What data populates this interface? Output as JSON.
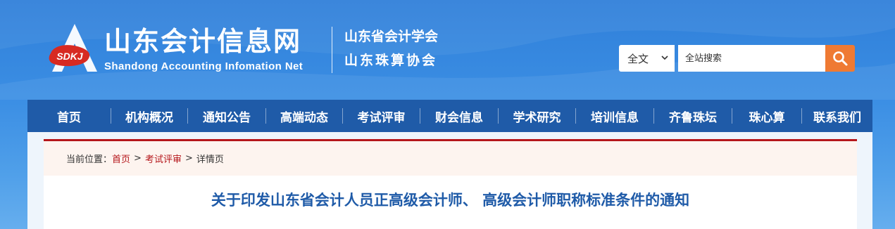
{
  "site": {
    "title": "山东会计信息网",
    "subtitle": "Shandong Accounting Infomation Net",
    "logo_badge": "SDKJ",
    "org_line1": "山东省会计学会",
    "org_line2": "山东珠算协会"
  },
  "search": {
    "scope_value": "全文",
    "placeholder": "全站搜索",
    "button_icon": "search-icon"
  },
  "nav": {
    "items": [
      {
        "label": "首页"
      },
      {
        "label": "机构概况"
      },
      {
        "label": "通知公告"
      },
      {
        "label": "高端动态"
      },
      {
        "label": "考试评审"
      },
      {
        "label": "财会信息"
      },
      {
        "label": "学术研究"
      },
      {
        "label": "培训信息"
      },
      {
        "label": "齐鲁珠坛"
      },
      {
        "label": "珠心算"
      },
      {
        "label": "联系我们"
      }
    ]
  },
  "breadcrumb": {
    "prefix": "当前位置：",
    "home": "首页",
    "separator": ">",
    "category": "考试评审",
    "current": "详情页"
  },
  "article": {
    "title": "关于印发山东省会计人员正高级会计师、 高级会计师职称标准条件的通知"
  },
  "colors": {
    "nav_bg": "#1f5ba8",
    "accent_red": "#b5161b",
    "search_button": "#ef7a33",
    "title_blue": "#1f5ba8"
  }
}
